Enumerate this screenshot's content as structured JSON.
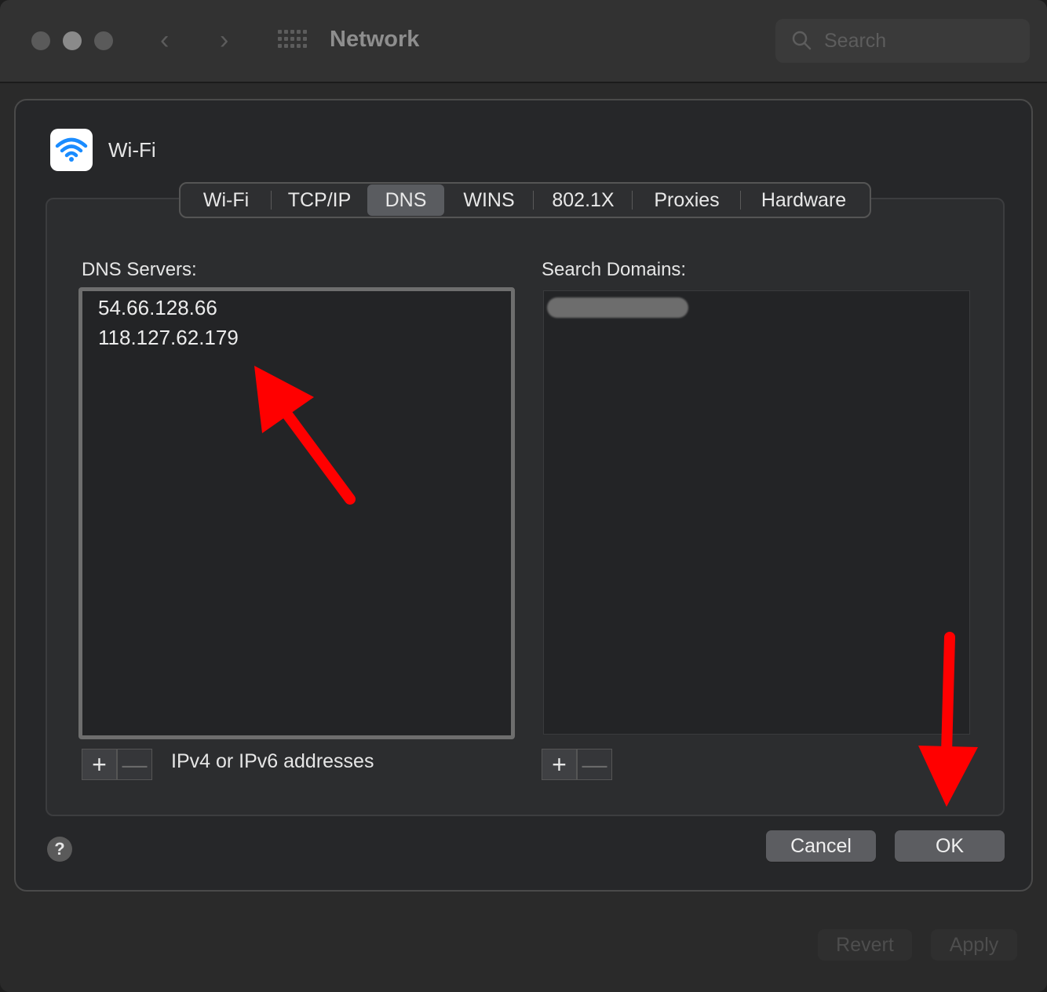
{
  "titlebar": {
    "title": "Network",
    "search_placeholder": "Search",
    "back_icon": "chevron-left-icon",
    "forward_icon": "chevron-right-icon",
    "grid_icon": "show-all-grid-icon"
  },
  "sheet": {
    "interface_name": "Wi-Fi",
    "interface_icon": "wifi-icon",
    "tabs": [
      {
        "label": "Wi-Fi",
        "active": false
      },
      {
        "label": "TCP/IP",
        "active": false
      },
      {
        "label": "DNS",
        "active": true
      },
      {
        "label": "WINS",
        "active": false
      },
      {
        "label": "802.1X",
        "active": false
      },
      {
        "label": "Proxies",
        "active": false
      },
      {
        "label": "Hardware",
        "active": false
      }
    ],
    "dns_servers": {
      "label": "DNS Servers:",
      "entries": [
        "54.66.128.66",
        "118.127.62.179"
      ],
      "add_label": "+",
      "remove_label": "—",
      "hint": "IPv4 or IPv6 addresses"
    },
    "search_domains": {
      "label": "Search Domains:",
      "add_label": "+",
      "remove_label": "—"
    },
    "help_label": "?",
    "cancel_label": "Cancel",
    "ok_label": "OK"
  },
  "footer": {
    "revert_label": "Revert",
    "apply_label": "Apply"
  },
  "colors": {
    "annotation_arrow": "#ff0000",
    "active_tab": "#5a5c60",
    "wifi_blue": "#1a8cff"
  }
}
